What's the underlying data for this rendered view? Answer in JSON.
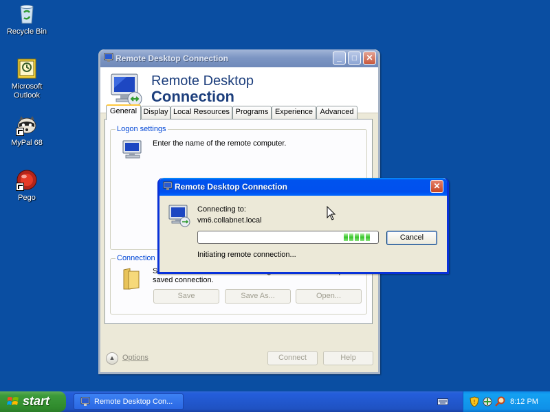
{
  "desktop": {
    "icons": [
      {
        "label": "Recycle Bin"
      },
      {
        "label": "Microsoft Outlook"
      },
      {
        "label": "MyPal 68"
      },
      {
        "label": "Pego"
      }
    ]
  },
  "main_window": {
    "title": "Remote Desktop Connection",
    "banner_line1": "Remote Desktop",
    "banner_line2": "Connection",
    "tabs": [
      {
        "label": "General",
        "selected": true
      },
      {
        "label": "Display"
      },
      {
        "label": "Local Resources"
      },
      {
        "label": "Programs"
      },
      {
        "label": "Experience"
      },
      {
        "label": "Advanced"
      }
    ],
    "logon_group": {
      "title": "Logon settings",
      "prompt": "Enter the name of the remote computer."
    },
    "connection_group": {
      "title": "Connection settings",
      "description": "Save the current connection settings to an RDP file or open a saved connection.",
      "save_label": "Save",
      "save_as_label": "Save As...",
      "open_label": "Open..."
    },
    "options_label": "Options",
    "connect_label": "Connect",
    "help_label": "Help"
  },
  "progress_dialog": {
    "title": "Remote Desktop Connection",
    "connecting_label": "Connecting to:",
    "host": "vm6.collabnet.local",
    "status": "Initiating remote connection...",
    "cancel_label": "Cancel",
    "progress_blocks": 5
  },
  "taskbar": {
    "start_label": "start",
    "task_item_label": "Remote Desktop Con...",
    "clock": "8:12 PM"
  },
  "colors": {
    "desktop": "#0a4ea2",
    "active_title": "#0053ee",
    "progress_green": "#4fc83a"
  }
}
